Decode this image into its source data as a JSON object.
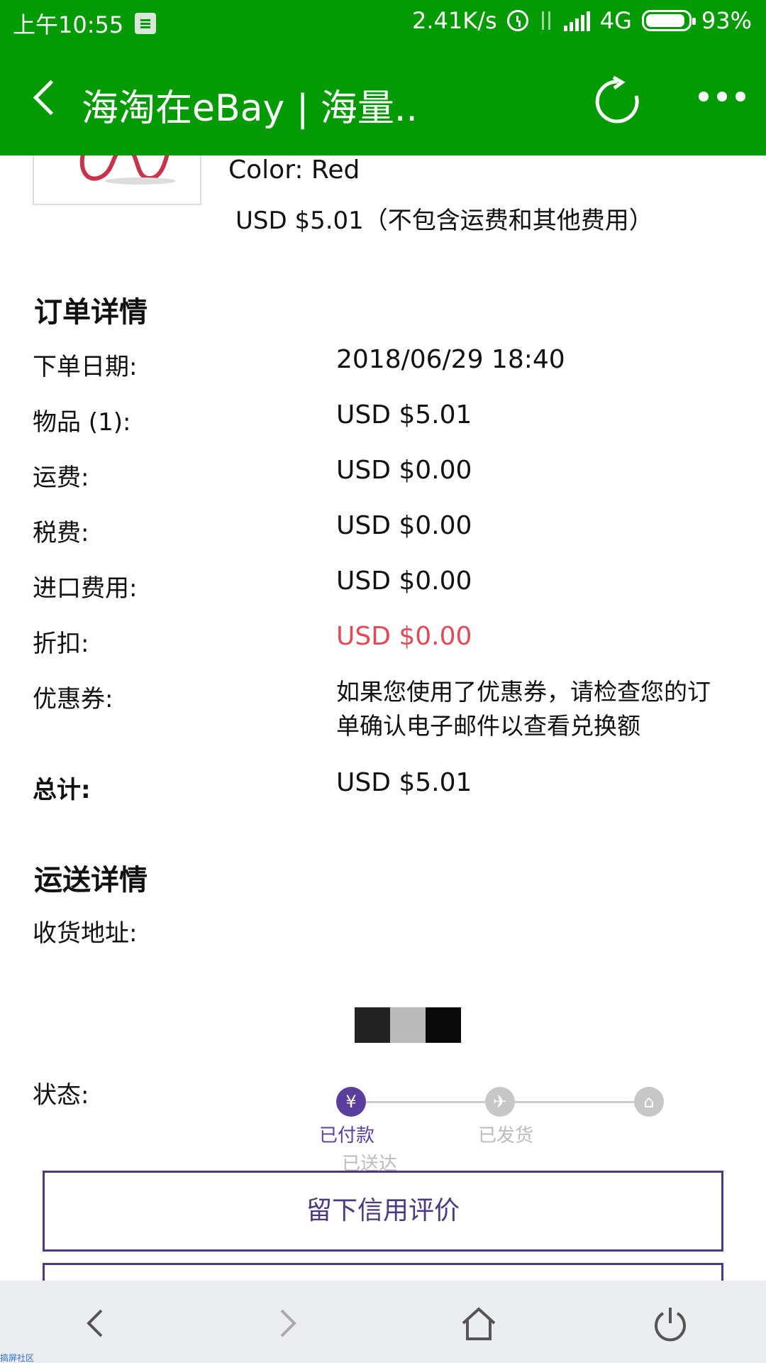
{
  "status_bar": {
    "time": "上午10:55",
    "speed": "2.41K/s",
    "network": "4G",
    "battery": "93%",
    "battery_level": 0.93
  },
  "app_bar": {
    "title": "海淘在eBay | 海量.."
  },
  "item": {
    "color": "Color: Red",
    "price": "USD $5.01（不包含运费和其他费用）"
  },
  "order": {
    "title": "订单详情",
    "rows": [
      {
        "label": "下单日期:",
        "value": "2018/06/29 18:40"
      },
      {
        "label": "物品 (1):",
        "value": "USD $5.01"
      },
      {
        "label": "运费:",
        "value": "USD $0.00"
      },
      {
        "label": "税费:",
        "value": "USD $0.00"
      },
      {
        "label": "进口费用:",
        "value": "USD $0.00"
      },
      {
        "label": "折扣:",
        "value": "USD $0.00"
      },
      {
        "label": "优惠券:",
        "value": "如果您使用了优惠券，请检查您的订单确认电子邮件以查看兑换额"
      },
      {
        "label": "总计:",
        "value": "USD $5.01"
      }
    ]
  },
  "shipping": {
    "title": "运送详情",
    "address_label": "收货地址:",
    "status_label": "状态:",
    "steps": [
      {
        "icon": "yuan-icon",
        "label": "已付款"
      },
      {
        "icon": "plane-icon",
        "label": "已发货"
      },
      {
        "icon": "home-icon",
        "label": "已送达"
      }
    ]
  },
  "actions": {
    "feedback": "留下信用评价"
  },
  "colors": {
    "brand_green": "#049a04",
    "accent_purple": "#4b3a82",
    "discount_red": "#e04b55"
  },
  "watermark": "搞屏社区"
}
